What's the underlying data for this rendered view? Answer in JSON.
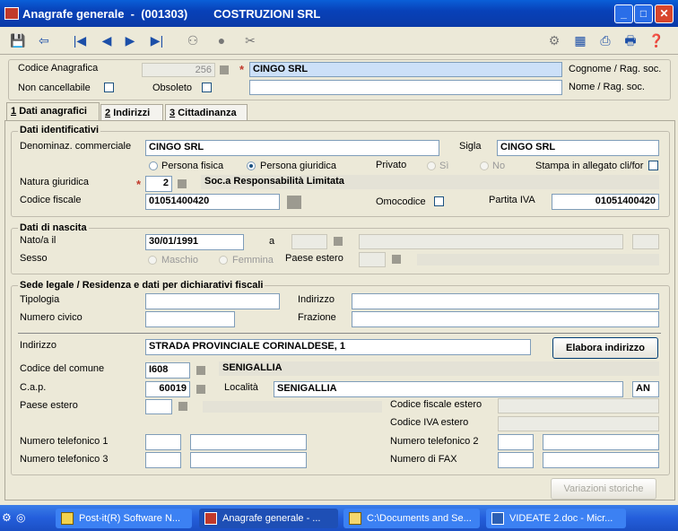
{
  "window": {
    "title": "Anagrafe generale  -  (001303)        COSTRUZIONI SRL"
  },
  "header": {
    "codice_label": "Codice Anagrafica",
    "codice_value": "256",
    "cognome_value": "CINGO SRL",
    "cognome_label": "Cognome / Rag. soc.",
    "nome_label": "Nome / Rag. soc.",
    "nome_value": "",
    "non_cancellabile_label": "Non cancellabile",
    "obsoleto_label": "Obsoleto"
  },
  "tabs": [
    {
      "num": "1",
      "label": "Dati anagrafici"
    },
    {
      "num": "2",
      "label": "Indirizzi"
    },
    {
      "num": "3",
      "label": "Cittadinanza"
    }
  ],
  "identificativi": {
    "title": "Dati identificativi",
    "denominaz_label": "Denominaz. commerciale",
    "denominaz_value": "CINGO SRL",
    "sigla_label": "Sigla",
    "sigla_value": "CINGO SRL",
    "persona_fisica_label": "Persona fisica",
    "persona_giuridica_label": "Persona giuridica",
    "privato_label": "Privato",
    "si_label": "Sì",
    "no_label": "No",
    "stampa_label": "Stampa in allegato cli/for",
    "natura_label": "Natura giuridica",
    "natura_code": "2",
    "natura_desc": "Soc.a Responsabilità Limitata",
    "cf_label": "Codice fiscale",
    "cf_value": "01051400420",
    "omocodice_label": "Omocodice",
    "piva_label": "Partita IVA",
    "piva_value": "01051400420"
  },
  "nascita": {
    "title": "Dati di nascita",
    "nato_label": "Nato/a il",
    "nato_value": "30/01/1991",
    "a_label": "a",
    "sesso_label": "Sesso",
    "maschio_label": "Maschio",
    "femmina_label": "Femmina",
    "paese_estero_label": "Paese estero"
  },
  "sede": {
    "title": "Sede legale / Residenza e dati per dichiarativi fiscali",
    "tipologia_label": "Tipologia",
    "indirizzo_top_label": "Indirizzo",
    "numero_civico_label": "Numero civico",
    "frazione_label": "Frazione",
    "indirizzo_label": "Indirizzo",
    "indirizzo_value": "STRADA PROVINCIALE CORINALDESE, 1",
    "elabora_button": "Elabora indirizzo",
    "comune_label": "Codice del comune",
    "comune_code": "I608",
    "comune_name": "SENIGALLIA",
    "cap_label": "C.a.p.",
    "cap_value": "60019",
    "localita_label": "Località",
    "localita_value": "SENIGALLIA",
    "prov_value": "AN",
    "paese_estero_label": "Paese estero",
    "cf_estero_label": "Codice fiscale estero",
    "civa_estero_label": "Codice IVA estero",
    "tel1_label": "Numero telefonico 1",
    "tel2_label": "Numero telefonico 2",
    "tel3_label": "Numero telefonico 3",
    "fax_label": "Numero di FAX"
  },
  "footer": {
    "variazioni_button": "Variazioni storiche"
  },
  "taskbar": {
    "items": [
      "Post-it(R) Software N...",
      "Anagrafe generale - ...",
      "C:\\Documents and Se...",
      "VIDEATE 2.doc - Micr..."
    ]
  },
  "colors": {
    "titlebar": "#0841b8",
    "taskbar": "#245edb",
    "window_bg": "#ece9d8",
    "required_star": "#c0392b"
  },
  "icons": [
    "save-icon",
    "back-icon",
    "first-icon",
    "prev-icon",
    "next-icon",
    "last-icon",
    "binoculars-icon",
    "circle-icon",
    "scissors-icon",
    "tools-icon",
    "calculator-icon",
    "print-icon",
    "printer-setup-icon",
    "help-icon"
  ]
}
